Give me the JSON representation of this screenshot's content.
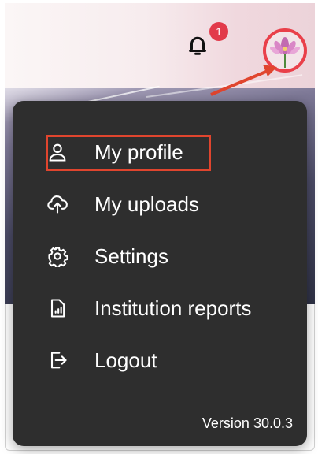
{
  "notifications": {
    "count": "1",
    "icon": "bell-icon"
  },
  "avatar": {
    "icon": "lotus-flower-avatar",
    "ring_color": "#e9404a"
  },
  "menu": {
    "items": [
      {
        "label": "My profile",
        "icon": "user-icon"
      },
      {
        "label": "My uploads",
        "icon": "cloud-upload-icon"
      },
      {
        "label": "Settings",
        "icon": "gear-icon"
      },
      {
        "label": "Institution reports",
        "icon": "report-chart-icon"
      },
      {
        "label": "Logout",
        "icon": "logout-icon"
      }
    ],
    "version": "Version 30.0.3",
    "highlighted_item": "My profile"
  },
  "colors": {
    "menu_bg": "#2e2e2e",
    "annotation": "#e0452e",
    "badge": "#e23a4a"
  }
}
